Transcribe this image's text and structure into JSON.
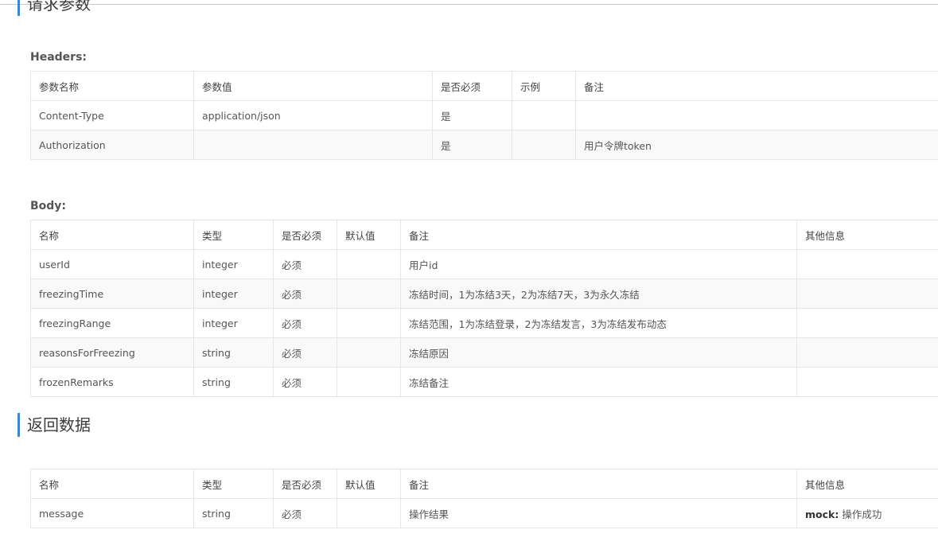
{
  "request_section": {
    "title": "请求参数"
  },
  "headers": {
    "label": "Headers:",
    "columns": [
      "参数名称",
      "参数值",
      "是否必须",
      "示例",
      "备注"
    ],
    "rows": [
      [
        "Content-Type",
        "application/json",
        "是",
        "",
        ""
      ],
      [
        "Authorization",
        "",
        "是",
        "",
        "用户令牌token"
      ]
    ]
  },
  "body": {
    "label": "Body:",
    "columns": [
      "名称",
      "类型",
      "是否必须",
      "默认值",
      "备注",
      "其他信息"
    ],
    "rows": [
      [
        "userId",
        "integer",
        "必须",
        "",
        "用户id",
        ""
      ],
      [
        "freezingTime",
        "integer",
        "必须",
        "",
        "冻结时间，1为冻结3天，2为冻结7天，3为永久冻结",
        ""
      ],
      [
        "freezingRange",
        "integer",
        "必须",
        "",
        "冻结范围，1为冻结登录，2为冻结发言，3为冻结发布动态",
        ""
      ],
      [
        "reasonsForFreezing",
        "string",
        "必须",
        "",
        "冻结原因",
        ""
      ],
      [
        "frozenRemarks",
        "string",
        "必须",
        "",
        "冻结备注",
        ""
      ]
    ]
  },
  "response_section": {
    "title": "返回数据"
  },
  "response": {
    "columns": [
      "名称",
      "类型",
      "是否必须",
      "默认值",
      "备注",
      "其他信息"
    ],
    "rows": [
      {
        "name": "message",
        "type": "string",
        "required": "必须",
        "default": "",
        "remark": "操作结果",
        "mock_key": "mock:",
        "mock_value": " 操作成功"
      }
    ]
  },
  "colors": {
    "accent": "#2b8ce4",
    "border": "#e6e6e6",
    "stripe": "#f9f9f9"
  }
}
